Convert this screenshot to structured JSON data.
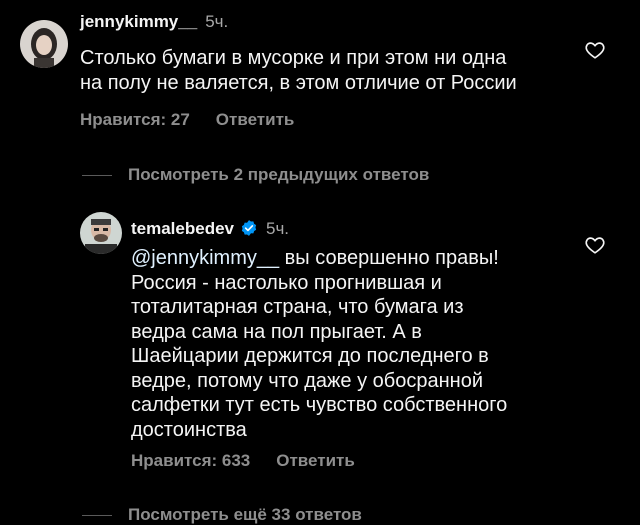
{
  "comment1": {
    "username": "jennykimmy__",
    "time": "5ч.",
    "text_line1": "Столько бумаги в мусорке и при этом ни одна",
    "text_line2": "на полу не валяется, в этом отличие от России",
    "likes_label": "Нравится: 27",
    "reply_label": "Ответить"
  },
  "view_previous_replies": "Посмотреть 2 предыдущих ответов",
  "comment2": {
    "username": "temalebedev",
    "time": "5ч.",
    "mention": "@jennykimmy__",
    "text_lines": [
      " вы совершенно правы!",
      "Россия - настолько прогнившая и",
      "тоталитарная страна, что бумага из",
      "ведра сама на пол прыгает. А в",
      "Шаейцарии держится до последнего в",
      "ведре, потому что даже у обосранной",
      "салфетки тут есть чувство собственного",
      "достоинства"
    ],
    "likes_label": "Нравится: 633",
    "reply_label": "Ответить"
  },
  "view_more_replies": "Посмотреть ещё 33 ответов",
  "colors": {
    "background": "#000000",
    "text": "#f5f5f5",
    "secondary": "#8e8e8e",
    "mention": "#e0f1ff",
    "verified": "#0095f6"
  },
  "icons": [
    "heart-outline-icon",
    "verified-badge-icon"
  ]
}
